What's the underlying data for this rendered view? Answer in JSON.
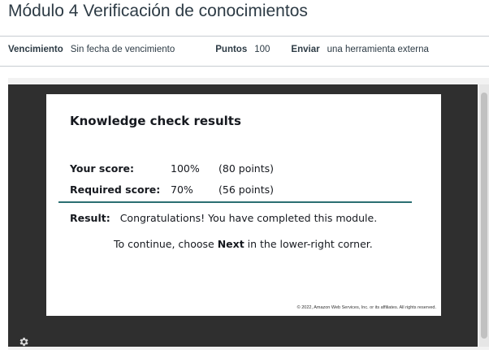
{
  "page": {
    "title": "Módulo 4 Verificación de conocimientos"
  },
  "details": {
    "due_label": "Vencimiento",
    "due_value": "Sin fecha de vencimiento",
    "points_label": "Puntos",
    "points_value": "100",
    "submit_label": "Enviar",
    "submit_value": "una herramienta externa"
  },
  "slide": {
    "heading": "Knowledge check results",
    "your_score_label": "Your score:",
    "your_score_percent": "100%",
    "your_score_points": "(80 points)",
    "required_score_label": "Required score:",
    "required_score_percent": "70%",
    "required_score_points": "(56 points)",
    "result_label": "Result:",
    "result_text": "Congratulations! You have completed this module.",
    "continue_before": "To continue, choose ",
    "continue_emphasis": "Next",
    "continue_after": " in the lower-right corner.",
    "copyright": "© 2022, Amazon Web Services, Inc. or its affiliates. All rights reserved."
  },
  "viewer": {
    "settings_icon": "gear-icon"
  },
  "colors": {
    "accent_rule": "#2a6f72",
    "stage_bg": "#2f2f2f"
  }
}
